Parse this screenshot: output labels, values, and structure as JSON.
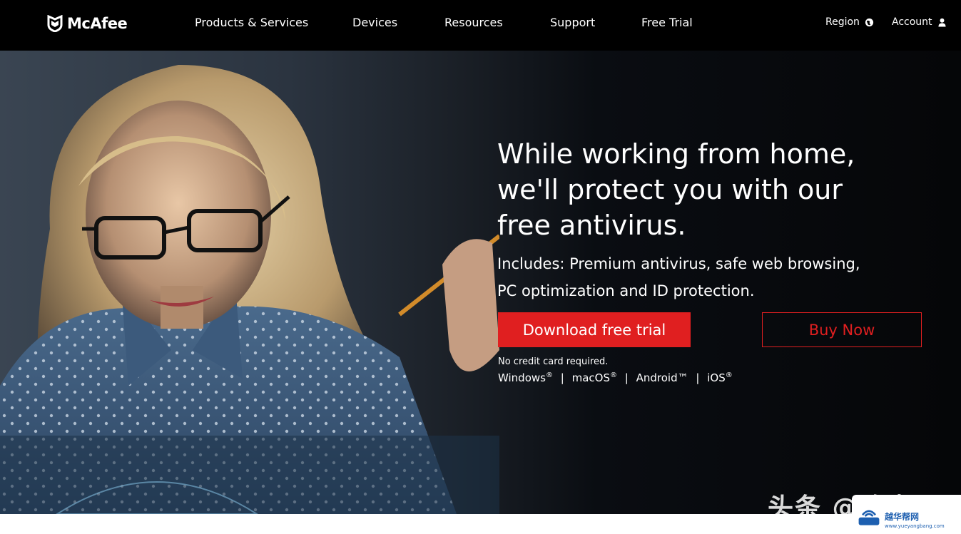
{
  "brand": {
    "name": "McAfee"
  },
  "nav": {
    "items": [
      "Products & Services",
      "Devices",
      "Resources",
      "Support",
      "Free Trial"
    ],
    "region_label": "Region",
    "account_label": "Account"
  },
  "hero": {
    "headline_lines": [
      "While working from home,",
      "we'll protect you with our",
      "free antivirus."
    ],
    "sub_lines": [
      "Includes: Premium antivirus, safe web browsing,",
      "PC optimization and ID protection."
    ],
    "cta_primary": "Download free trial",
    "cta_secondary": "Buy Now",
    "note": "No credit card required.",
    "platforms": {
      "windows": "Windows",
      "macos": "macOS",
      "android": "Android™",
      "ios": "iOS",
      "reg_mark": "®",
      "separator": "|"
    }
  },
  "watermark": {
    "text": "头条 @路由器",
    "badge_title": "越华帮网",
    "badge_url": "www.yueyangbang.com"
  },
  "colors": {
    "accent": "#e01f20",
    "nav_bg": "#000000",
    "text": "#ffffff"
  }
}
